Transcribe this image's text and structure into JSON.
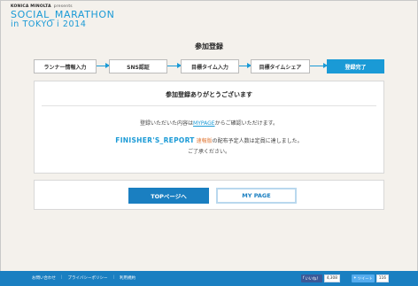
{
  "header": {
    "sponsor": "KONICA MINOLTA",
    "presents": "presents",
    "logo_line1": "SOCIAL_MARATHON",
    "logo_line2": "in TOKYO i 2014"
  },
  "page_title": "参加登録",
  "steps": [
    {
      "label": "ランナー情報入力"
    },
    {
      "label": "SNS認証"
    },
    {
      "label": "目標タイム入力"
    },
    {
      "label": "目標タイムシェア"
    },
    {
      "label": "登録完了"
    }
  ],
  "main": {
    "thanks": "参加登録ありがとうございます",
    "confirm_prefix": "登録いただいた内容は",
    "confirm_link": "MYPAGE",
    "confirm_suffix": "からご確認いただけます。",
    "finisher_report": "FINISHER'S_REPORT",
    "finisher_flash": "速報版",
    "finisher_suffix": "の配布予定人数は定員に達しました。",
    "notice": "ご了承ください。"
  },
  "buttons": {
    "top_page": "TOPページへ",
    "my_page": "MY PAGE"
  },
  "footer": {
    "links": [
      "お問い合わせ",
      "プライバシーポリシー",
      "利用規約"
    ],
    "fb_label": "いいね！",
    "fb_count": "4,308",
    "tw_label": "ツイート",
    "tw_count": "116"
  },
  "colors": {
    "accent": "#1a9ad6",
    "footer": "#1a7fc1",
    "background": "#f4f1ec"
  }
}
